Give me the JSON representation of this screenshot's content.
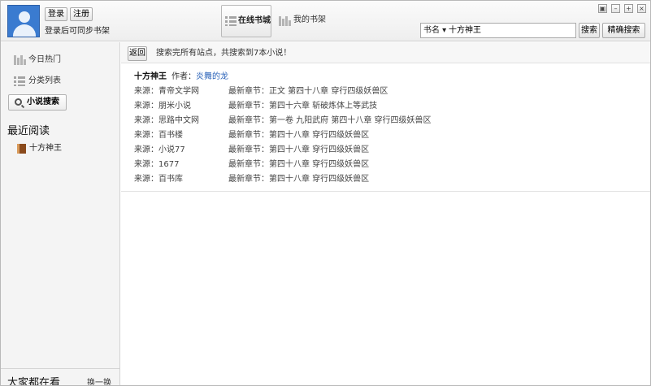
{
  "header": {
    "login_label": "登录",
    "register_label": "注册",
    "sync_text": "登录后可同步书架",
    "tab_online": "在线书城",
    "tab_shelf": "我的书架",
    "search_type": "书名",
    "search_value": "十方神王",
    "search_button": "搜索",
    "exact_search_button": "精确搜索",
    "window_controls": [
      "restore-icon",
      "minimize-icon",
      "maximize-icon",
      "close-icon"
    ]
  },
  "sidebar": {
    "items": [
      {
        "label": "今日热门",
        "icon": "books-icon"
      },
      {
        "label": "分类列表",
        "icon": "list-icon"
      },
      {
        "label": "小说搜索",
        "icon": "search-icon"
      }
    ],
    "recent_title": "最近阅读",
    "recent_books": [
      {
        "title": "十方神王",
        "icon": "book-icon"
      }
    ],
    "everyone_title": "大家都在看",
    "swap_label": "换一换"
  },
  "main": {
    "back_label": "返回",
    "status_text": "搜索完所有站点，共搜索到7本小说！",
    "book_title": "十方神王",
    "author_label": "作者：",
    "author_name": "炎舞的龙",
    "results": [
      {
        "source": "来源：青帝文学网",
        "chapter": "最新章节：正文 第四十八章 穿行四级妖兽区"
      },
      {
        "source": "来源：朋米小说",
        "chapter": "最新章节：第四十六章 斩破炼体上等武技"
      },
      {
        "source": "来源：思路中文网",
        "chapter": "最新章节：第一卷 九阳武府 第四十八章 穿行四级妖兽区"
      },
      {
        "source": "来源：百书楼",
        "chapter": "最新章节：第四十八章 穿行四级妖兽区"
      },
      {
        "source": "来源：小说77",
        "chapter": "最新章节：第四十八章 穿行四级妖兽区"
      },
      {
        "source": "来源：1677",
        "chapter": "最新章节：第四十八章 穿行四级妖兽区"
      },
      {
        "source": "来源：百书库",
        "chapter": "最新章节：第四十八章 穿行四级妖兽区"
      }
    ]
  }
}
